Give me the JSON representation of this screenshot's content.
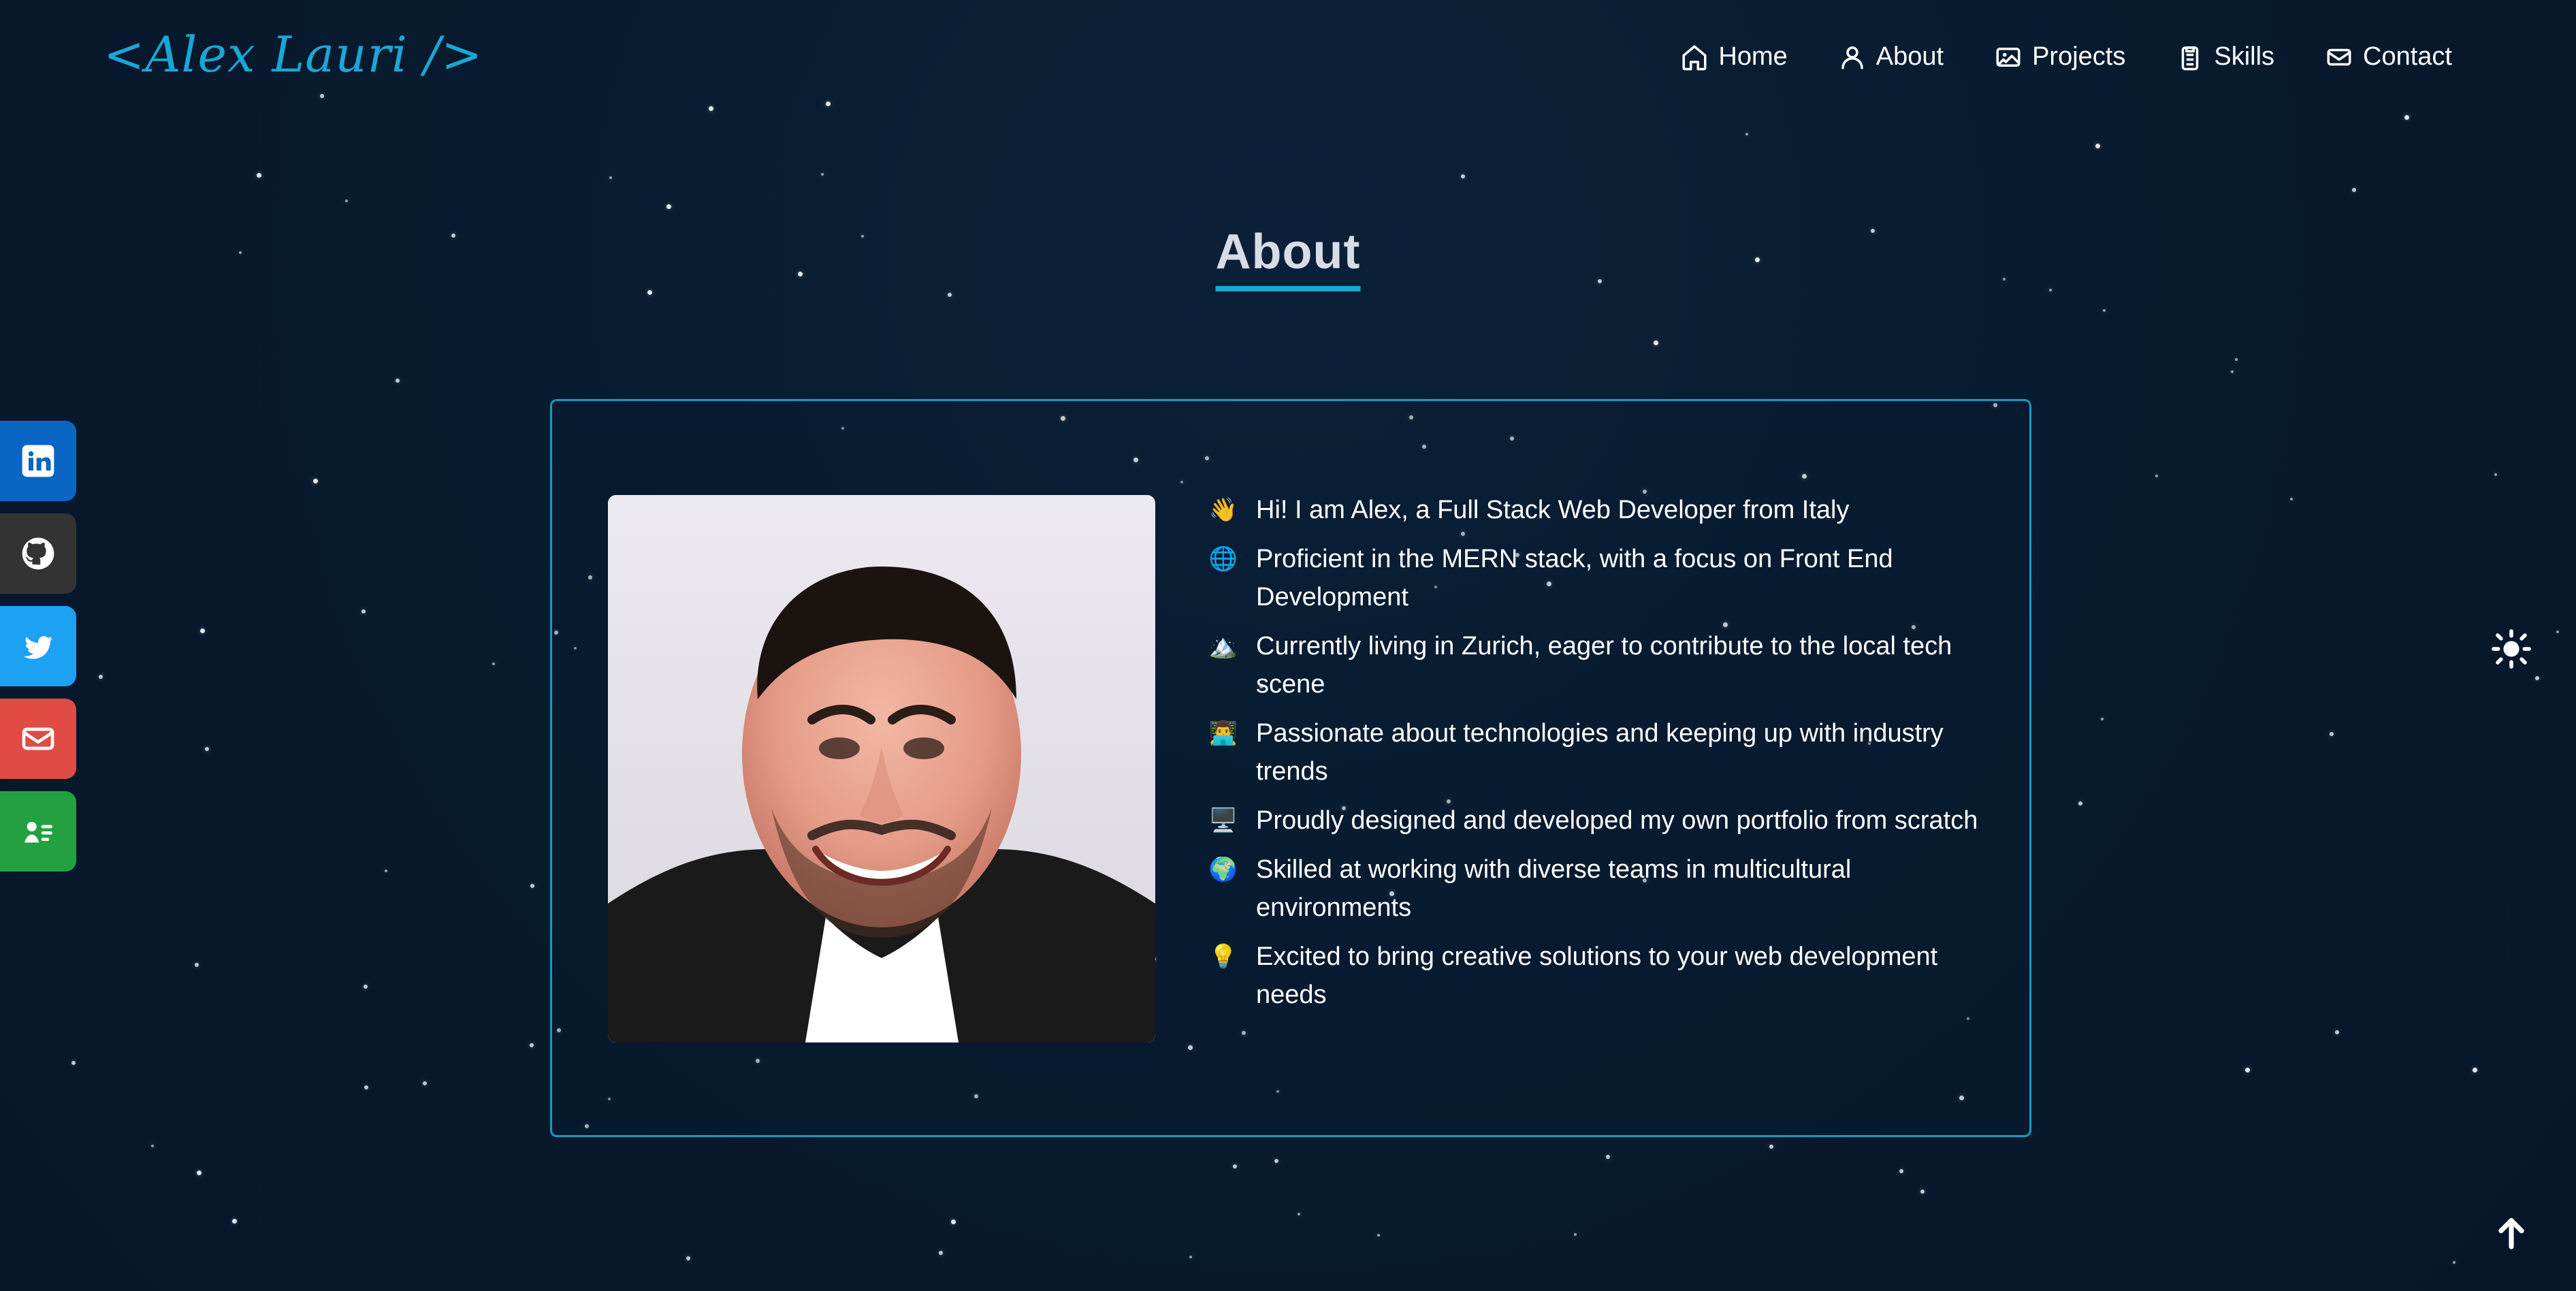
{
  "brand": {
    "logo_text": "<Alex Lauri />"
  },
  "nav": {
    "items": [
      {
        "label": "Home",
        "icon": "home-icon"
      },
      {
        "label": "About",
        "icon": "user-icon"
      },
      {
        "label": "Projects",
        "icon": "image-icon"
      },
      {
        "label": "Skills",
        "icon": "clipboard-icon"
      },
      {
        "label": "Contact",
        "icon": "mail-icon"
      }
    ]
  },
  "section": {
    "title": "About"
  },
  "about": {
    "bullets": [
      {
        "emoji": "👋",
        "text": "Hi! I am Alex, a Full Stack Web Developer from Italy"
      },
      {
        "emoji": "🌐",
        "text": "Proficient in the MERN stack, with a focus on Front End Development"
      },
      {
        "emoji": "🏔️",
        "text": "Currently living in Zurich, eager to contribute to the local tech scene"
      },
      {
        "emoji": "👨‍💻",
        "text": "Passionate about technologies and keeping up with industry trends"
      },
      {
        "emoji": "🖥️",
        "text": "Proudly designed and developed my own portfolio from scratch"
      },
      {
        "emoji": "🌍",
        "text": "Skilled at working with diverse teams in multicultural environments"
      },
      {
        "emoji": "💡",
        "text": "Excited to bring creative solutions to your web development needs"
      }
    ]
  },
  "social": {
    "items": [
      {
        "name": "linkedin",
        "icon": "linkedin-icon"
      },
      {
        "name": "github",
        "icon": "github-icon"
      },
      {
        "name": "twitter",
        "icon": "twitter-icon"
      },
      {
        "name": "email",
        "icon": "email-icon"
      },
      {
        "name": "contact-card",
        "icon": "contact-card-icon"
      }
    ]
  },
  "controls": {
    "theme_toggle_icon": "sun-icon",
    "scroll_top_icon": "arrow-up-icon"
  },
  "colors": {
    "background": "#081a2e",
    "accent": "#19a7d6",
    "linkedin": "#0a66c2",
    "github": "#333333",
    "twitter": "#1da1f2",
    "email": "#e04b43",
    "contact": "#23a140"
  }
}
